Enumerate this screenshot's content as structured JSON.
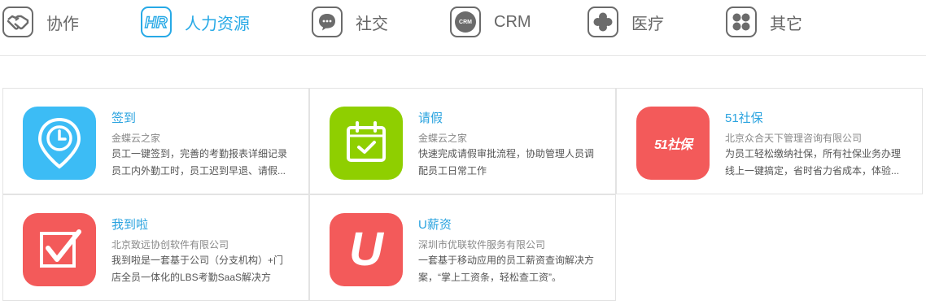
{
  "tabs": [
    {
      "label": "协作",
      "icon": "handshake-icon",
      "active": false
    },
    {
      "label": "人力资源",
      "icon": "hr-icon",
      "active": true
    },
    {
      "label": "社交",
      "icon": "chat-bubble-icon",
      "active": false
    },
    {
      "label": "CRM",
      "icon": "crm-icon",
      "active": false,
      "icon_text": "CRM"
    },
    {
      "label": "医疗",
      "icon": "medical-cross-icon",
      "active": false
    },
    {
      "label": "其它",
      "icon": "four-dots-icon",
      "active": false
    }
  ],
  "apps": [
    {
      "name": "签到",
      "vendor": "金蝶云之家",
      "description": "员工一键签到，完善的考勤报表详细记录员工内外勤工时，员工迟到早退、请假...",
      "icon": "location-clock-icon",
      "color": "#3cbcf5"
    },
    {
      "name": "请假",
      "vendor": "金蝶云之家",
      "description": "快速完成请假审批流程，协助管理人员调配员工日常工作",
      "icon": "calendar-check-icon",
      "color": "#8fcf00"
    },
    {
      "name": "51社保",
      "vendor": "北京众合天下管理咨询有限公司",
      "description": "为员工轻松缴纳社保，所有社保业务办理线上一键搞定，省时省力省成本，体验...",
      "icon": "51shebao-logo-icon",
      "color": "#f35a5a",
      "icon_text": "51社保"
    },
    {
      "name": "我到啦",
      "vendor": "北京致远协创软件有限公司",
      "description": "我到啦是一套基于公司（分支机构）+门店全员一体化的LBS考勤SaaS解决方案。..",
      "icon": "checkbox-check-icon",
      "color": "#f35a5a"
    },
    {
      "name": "U薪资",
      "vendor": "深圳市优联软件服务有限公司",
      "description": "一套基于移动应用的员工薪资查询解决方案，“掌上工资条，轻松查工资”。",
      "icon": "u-logo-icon",
      "color": "#f35a5a",
      "icon_text": "U"
    }
  ],
  "colors": {
    "accent": "#27a9e6",
    "icon_gray": "#6b6b6b",
    "border": "#e3e3e3"
  }
}
